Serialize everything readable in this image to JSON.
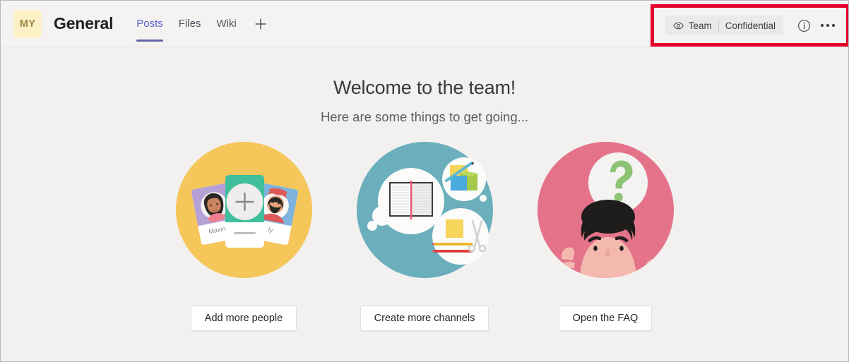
{
  "header": {
    "team_avatar_initials": "MY",
    "channel_title": "General",
    "tabs": [
      {
        "label": "Posts",
        "active": true
      },
      {
        "label": "Files",
        "active": false
      },
      {
        "label": "Wiki",
        "active": false
      }
    ],
    "add_tab_icon": "plus-icon",
    "sensitivity": {
      "eye_icon": "eye-icon",
      "scope_label": "Team",
      "classification_label": "Confidential"
    },
    "info_icon": "info-circle-icon",
    "more_icon": "more-options-icon",
    "highlight_color": "#e4002b"
  },
  "main": {
    "title": "Welcome to the team!",
    "subtitle": "Here are some things to get going...",
    "cards": [
      {
        "illustration_name": "people-cards-illustration",
        "circle_color": "#f5c65a",
        "person_name_left": "Maxine",
        "person_name_right": "ly",
        "button_label": "Add more people"
      },
      {
        "illustration_name": "channels-notebook-illustration",
        "circle_color": "#6bafbd",
        "button_label": "Create more channels"
      },
      {
        "illustration_name": "faq-question-illustration",
        "circle_color": "#e4738a",
        "button_label": "Open the FAQ"
      }
    ]
  }
}
